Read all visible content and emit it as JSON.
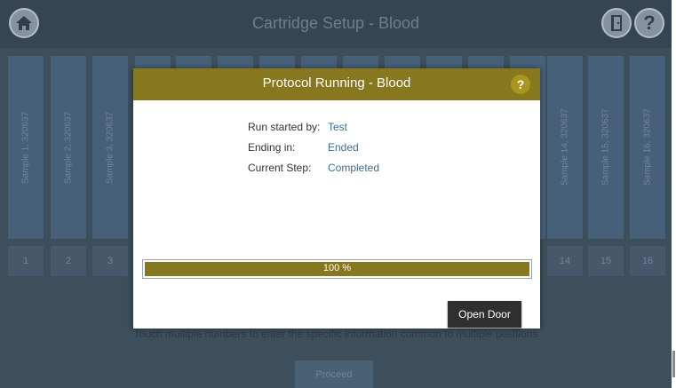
{
  "header": {
    "title": "Cartridge Setup - Blood",
    "icons": [
      "home-icon",
      "door-icon",
      "help-icon"
    ],
    "help_glyph": "?"
  },
  "cartridge": {
    "left_columns": [
      "Sample 1, 320637",
      "Sample 2, 320637",
      "Sample 3, 320637"
    ],
    "right_columns": [
      "Sample 14, 320637",
      "Sample 15, 320637",
      "Sample 16, 320637"
    ],
    "left_numbers": [
      "1",
      "2",
      "3"
    ],
    "right_numbers": [
      "14",
      "15",
      "16"
    ]
  },
  "instruction": "Touch multiple numbers to enter the specific information common to multiple positions",
  "proceed_label": "Proceed",
  "modal": {
    "title": "Protocol Running - Blood",
    "help_glyph": "?",
    "rows": [
      {
        "label": "Run started by:",
        "value": "Test"
      },
      {
        "label": "Ending in:",
        "value": "Ended"
      },
      {
        "label": "Current Step:",
        "value": "Completed"
      }
    ],
    "progress": {
      "percent": 100,
      "text": "100 %"
    },
    "open_door_label": "Open Door"
  },
  "colors": {
    "accent": "#87771f",
    "dark_button": "#2f2f2f",
    "link_value": "#3d6e94",
    "background": "#3d4e5c"
  }
}
